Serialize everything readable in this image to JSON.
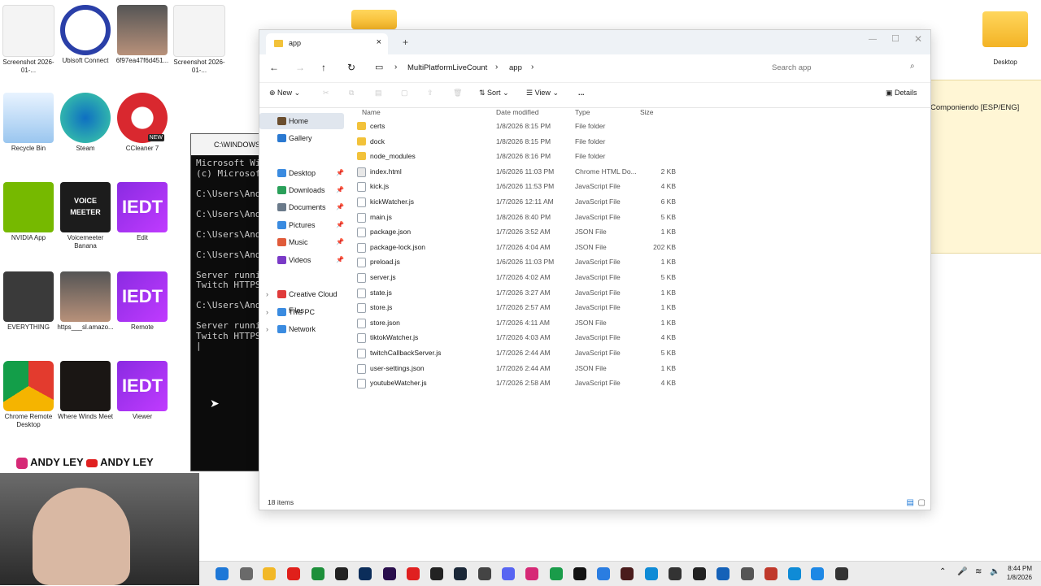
{
  "desktop": {
    "icons": [
      {
        "label": "Screenshot 2026-01-...",
        "kind": "screenshot"
      },
      {
        "label": "Ubisoft Connect",
        "kind": "ubisoft"
      },
      {
        "label": "6f97ea47f6d451...",
        "kind": "photo"
      },
      {
        "label": "Screenshot 2026-01-...",
        "kind": "screenshot"
      },
      {
        "label": "Recycle Bin",
        "kind": "recycle"
      },
      {
        "label": "Steam",
        "kind": "edge"
      },
      {
        "label": "CCleaner 7",
        "kind": "ccleaner"
      },
      {
        "label": "NVIDIA App",
        "kind": "nvidia"
      },
      {
        "label": "Voicemeeter Banana",
        "kind": "voicemeeter"
      },
      {
        "label": "Edit",
        "kind": "iedt"
      },
      {
        "label": "EVERYTHING",
        "kind": "chip"
      },
      {
        "label": "https___sl.amazo...",
        "kind": "photo"
      },
      {
        "label": "Remote",
        "kind": "iedt"
      },
      {
        "label": "Chrome Remote Desktop",
        "kind": "chrome"
      },
      {
        "label": "Where Winds Meet",
        "kind": "wwm"
      },
      {
        "label": "Viewer",
        "kind": "iedt"
      }
    ],
    "top_folder_label": "Desktop",
    "iedt_text": "IEDT",
    "voicemeeter_text": "VOICE MEETER",
    "banner_text": "ANDY LEY",
    "new_badge": "NEW"
  },
  "cmd": {
    "title": "C:\\WINDOWS\\",
    "lines": [
      "Microsoft Win",
      "(c) Microsoft",
      "",
      "C:\\Users\\Andy",
      "",
      "C:\\Users\\Andy",
      "",
      "C:\\Users\\Andy",
      "",
      "C:\\Users\\Andy",
      "",
      "Server runnin",
      "Twitch HTTPS",
      "",
      "C:\\Users\\Andy",
      "",
      "Server runnin",
      "Twitch HTTPS",
      "|"
    ]
  },
  "explorer": {
    "tab_title": "app",
    "breadcrumb": [
      "MultiPlatformLiveCount",
      "app"
    ],
    "search_placeholder": "Search app",
    "toolbar": {
      "new": "New",
      "sort": "Sort",
      "view": "View",
      "more": "...",
      "details": "Details"
    },
    "nav": [
      {
        "label": "Home",
        "icon": "home-icon",
        "selected": true
      },
      {
        "label": "Gallery",
        "icon": "gallery-icon"
      },
      {
        "label": "Desktop",
        "icon": "desktop-icon",
        "pinned": true
      },
      {
        "label": "Downloads",
        "icon": "downloads-icon",
        "pinned": true
      },
      {
        "label": "Documents",
        "icon": "documents-icon",
        "pinned": true
      },
      {
        "label": "Pictures",
        "icon": "pictures-icon",
        "pinned": true
      },
      {
        "label": "Music",
        "icon": "music-icon",
        "pinned": true
      },
      {
        "label": "Videos",
        "icon": "videos-icon",
        "pinned": true
      },
      {
        "label": "Creative Cloud Files",
        "icon": "cloud-icon",
        "expandable": true
      },
      {
        "label": "This PC",
        "icon": "pc-icon",
        "expandable": true
      },
      {
        "label": "Network",
        "icon": "network-icon",
        "expandable": true
      }
    ],
    "columns": [
      "Name",
      "Date modified",
      "Type",
      "Size"
    ],
    "files": [
      {
        "name": "certs",
        "date": "1/8/2026 8:15 PM",
        "type": "File folder",
        "size": "",
        "kind": "folder"
      },
      {
        "name": "dock",
        "date": "1/8/2026 8:15 PM",
        "type": "File folder",
        "size": "",
        "kind": "folder"
      },
      {
        "name": "node_modules",
        "date": "1/8/2026 8:16 PM",
        "type": "File folder",
        "size": "",
        "kind": "folder"
      },
      {
        "name": "index.html",
        "date": "1/6/2026 11:03 PM",
        "type": "Chrome HTML Do...",
        "size": "2 KB",
        "kind": "html"
      },
      {
        "name": "kick.js",
        "date": "1/6/2026 11:53 PM",
        "type": "JavaScript File",
        "size": "4 KB",
        "kind": "file"
      },
      {
        "name": "kickWatcher.js",
        "date": "1/7/2026 12:11 AM",
        "type": "JavaScript File",
        "size": "6 KB",
        "kind": "file"
      },
      {
        "name": "main.js",
        "date": "1/8/2026 8:40 PM",
        "type": "JavaScript File",
        "size": "5 KB",
        "kind": "file"
      },
      {
        "name": "package.json",
        "date": "1/7/2026 3:52 AM",
        "type": "JSON File",
        "size": "1 KB",
        "kind": "file"
      },
      {
        "name": "package-lock.json",
        "date": "1/7/2026 4:04 AM",
        "type": "JSON File",
        "size": "202 KB",
        "kind": "file"
      },
      {
        "name": "preload.js",
        "date": "1/6/2026 11:03 PM",
        "type": "JavaScript File",
        "size": "1 KB",
        "kind": "file"
      },
      {
        "name": "server.js",
        "date": "1/7/2026 4:02 AM",
        "type": "JavaScript File",
        "size": "5 KB",
        "kind": "file"
      },
      {
        "name": "state.js",
        "date": "1/7/2026 3:27 AM",
        "type": "JavaScript File",
        "size": "1 KB",
        "kind": "file"
      },
      {
        "name": "store.js",
        "date": "1/7/2026 2:57 AM",
        "type": "JavaScript File",
        "size": "1 KB",
        "kind": "file"
      },
      {
        "name": "store.json",
        "date": "1/7/2026 4:11 AM",
        "type": "JSON File",
        "size": "1 KB",
        "kind": "file"
      },
      {
        "name": "tiktokWatcher.js",
        "date": "1/7/2026 4:03 AM",
        "type": "JavaScript File",
        "size": "4 KB",
        "kind": "file"
      },
      {
        "name": "twitchCallbackServer.js",
        "date": "1/7/2026 2:44 AM",
        "type": "JavaScript File",
        "size": "5 KB",
        "kind": "file"
      },
      {
        "name": "user-settings.json",
        "date": "1/7/2026 2:44 AM",
        "type": "JSON File",
        "size": "1 KB",
        "kind": "file"
      },
      {
        "name": "youtubeWatcher.js",
        "date": "1/7/2026 2:58 AM",
        "type": "JavaScript File",
        "size": "4 KB",
        "kind": "file"
      }
    ],
    "status": "18 items"
  },
  "right_panel": {
    "text": "Componiendo [ESP/ENG]"
  },
  "taskbar": {
    "time": "8:44 PM",
    "date": "1/8/2026",
    "apps": [
      {
        "name": "start-icon",
        "color": "#1e78d7"
      },
      {
        "name": "app-icon",
        "color": "#6a6a6a"
      },
      {
        "name": "file-explorer-icon",
        "color": "#f2b827"
      },
      {
        "name": "opera-icon",
        "color": "#e0201b"
      },
      {
        "name": "xbox-icon",
        "color": "#1d8f3a"
      },
      {
        "name": "app-icon",
        "color": "#222222"
      },
      {
        "name": "photoshop-icon",
        "color": "#0b2d5a"
      },
      {
        "name": "premiere-icon",
        "color": "#2a0f4d"
      },
      {
        "name": "youtube-icon",
        "color": "#e02020"
      },
      {
        "name": "epic-games-icon",
        "color": "#222222"
      },
      {
        "name": "steam-icon",
        "color": "#1b2838"
      },
      {
        "name": "app-icon",
        "color": "#444444"
      },
      {
        "name": "discord-icon",
        "color": "#5865f2"
      },
      {
        "name": "instagram-icon",
        "color": "#d62976"
      },
      {
        "name": "chrome-icon",
        "color": "#1a9c4a"
      },
      {
        "name": "tiktok-icon",
        "color": "#111111"
      },
      {
        "name": "app-icon",
        "color": "#2a7de1"
      },
      {
        "name": "obs-icon",
        "color": "#4a1c1c"
      },
      {
        "name": "edge-icon",
        "color": "#0f8bd6"
      },
      {
        "name": "app-icon",
        "color": "#333333"
      },
      {
        "name": "terminal-icon",
        "color": "#222222"
      },
      {
        "name": "app-icon",
        "color": "#1562b8"
      },
      {
        "name": "app-icon",
        "color": "#555555"
      },
      {
        "name": "app-icon",
        "color": "#c0392b"
      },
      {
        "name": "edge-icon",
        "color": "#0f8bd6"
      },
      {
        "name": "app-icon",
        "color": "#1e88e5"
      },
      {
        "name": "app-icon",
        "color": "#333333"
      }
    ]
  }
}
